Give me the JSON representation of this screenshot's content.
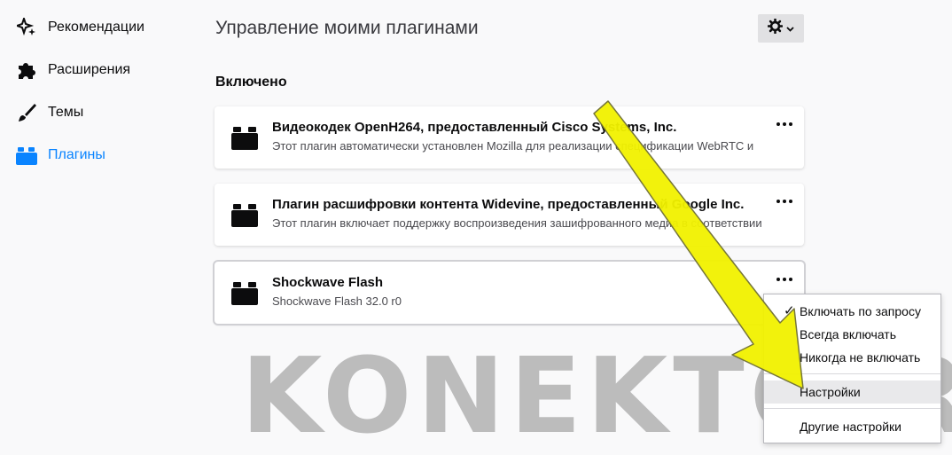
{
  "sidebar": {
    "items": [
      {
        "label": "Рекомендации",
        "icon": "sparkle-icon"
      },
      {
        "label": "Расширения",
        "icon": "puzzle-icon"
      },
      {
        "label": "Темы",
        "icon": "brush-icon"
      },
      {
        "label": "Плагины",
        "icon": "plugin-icon",
        "selected": true
      }
    ]
  },
  "main": {
    "title": "Управление моими плагинами",
    "section": "Включено",
    "plugins": [
      {
        "name": "Видеокодек OpenH264, предоставленный Cisco Systems, Inc.",
        "description": "Этот плагин автоматически установлен Mozilla для реализации спецификации WebRTC и"
      },
      {
        "name": "Плагин расшифровки контента Widevine, предоставленный Google Inc.",
        "description": "Этот плагин включает поддержку воспроизведения зашифрованного медиа в соответствии"
      },
      {
        "name": "Shockwave Flash",
        "description": "Shockwave Flash 32.0 r0"
      }
    ]
  },
  "menu": {
    "items": [
      {
        "label": "Включать по запросу",
        "checked": true
      },
      {
        "label": "Всегда включать"
      },
      {
        "label": "Никогда не включать"
      },
      {
        "label": "Настройки",
        "hover": true
      },
      {
        "label": "Другие настройки"
      }
    ]
  },
  "watermark": "KONEKTO.RU",
  "colors": {
    "accent": "#0a84ff",
    "arrow": "#f5f500"
  }
}
